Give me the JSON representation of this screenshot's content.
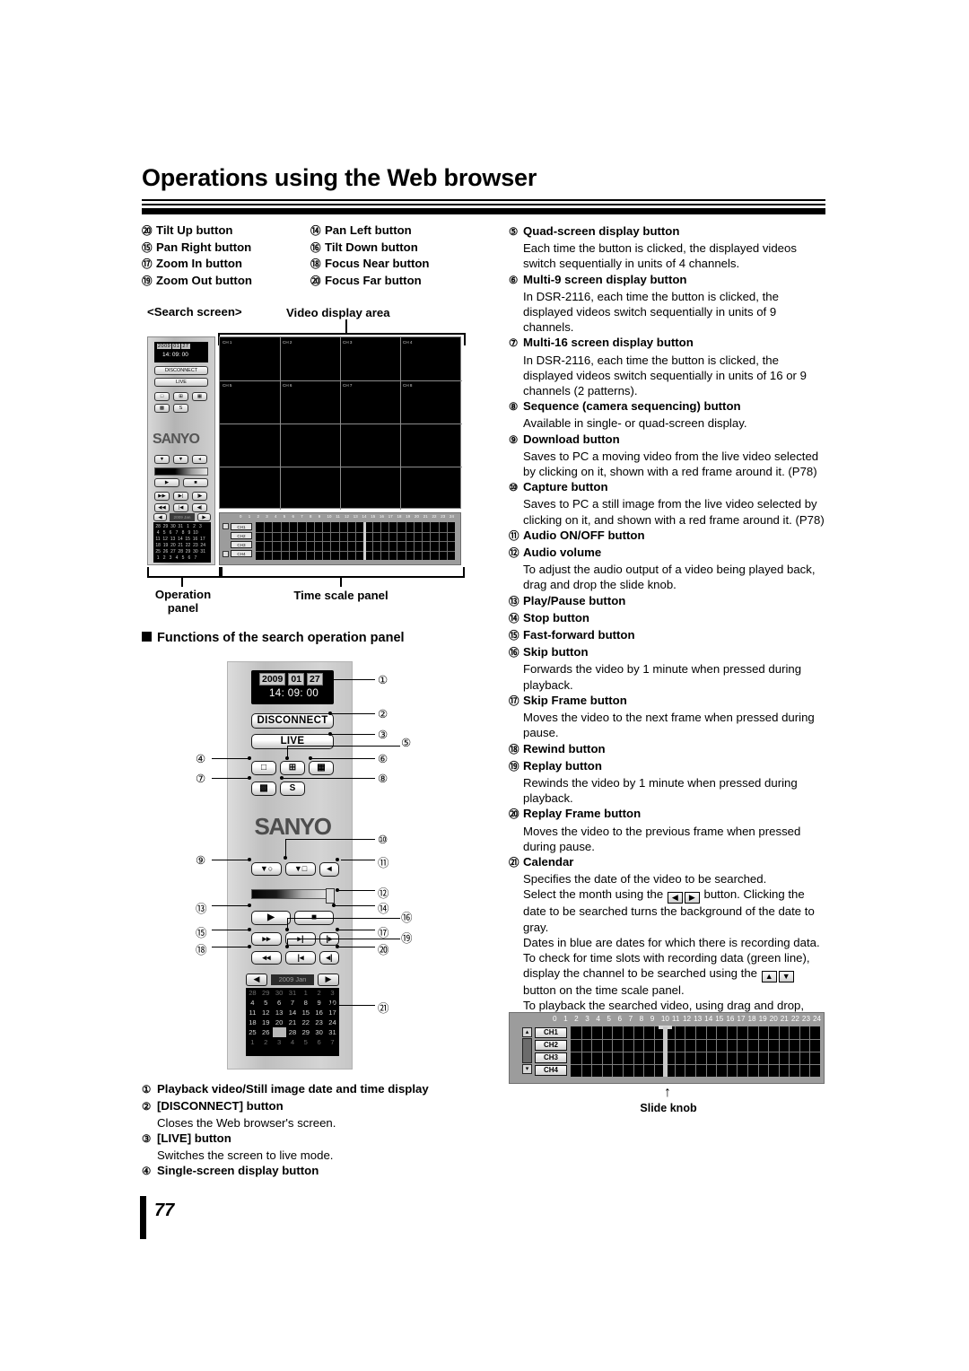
{
  "header": {
    "title": "Operations using the Web browser"
  },
  "ptz_list": {
    "column_a": [
      {
        "num": "⑳",
        "label": "Tilt Up button"
      },
      {
        "num": "⑮",
        "label": "Pan Right button"
      },
      {
        "num": "⑰",
        "label": "Zoom In button"
      },
      {
        "num": "⑲",
        "label": "Zoom Out button"
      }
    ],
    "column_b": [
      {
        "num": "⑭",
        "label": "Pan Left button"
      },
      {
        "num": "⑯",
        "label": "Tilt Down button"
      },
      {
        "num": "⑱",
        "label": "Focus Near button"
      },
      {
        "num": "⑳\u0000",
        "label": "Focus Far button"
      }
    ],
    "column_b_nums": [
      "⑭",
      "⑯",
      "⑱",
      "⑳"
    ],
    "column_b_num_20": "⑳"
  },
  "figure_search": {
    "caption": "<Search screen>",
    "video_area_label": "Video display area",
    "operation_panel_label_line1": "Operation",
    "operation_panel_label_line2": "panel",
    "time_scale_panel_label": "Time scale panel",
    "mini_panel": {
      "date_year": "2009",
      "date_month": "01",
      "date_day": "27",
      "time": "14: 09: 00",
      "disconnect": "DISCONNECT",
      "live": "LIVE",
      "brand": "SANYO",
      "s_button": "S",
      "calendar_month": "2009 Jan"
    },
    "video_channels": [
      "CH 1",
      "CH 2",
      "CH 3",
      "CH 4",
      "CH 5",
      "CH 6",
      "CH 7",
      "CH 8"
    ],
    "time_scale_channels": [
      "CH1",
      "CH2",
      "CH3",
      "CH4"
    ],
    "time_scale_hours": [
      "0",
      "1",
      "2",
      "3",
      "4",
      "5",
      "6",
      "7",
      "8",
      "9",
      "10",
      "11",
      "12",
      "13",
      "14",
      "15",
      "16",
      "17",
      "18",
      "19",
      "20",
      "21",
      "22",
      "23",
      "24"
    ]
  },
  "section_heading": "Functions of the search operation panel",
  "figure_panel": {
    "date_year": "2009",
    "date_month": "01",
    "date_day": "27",
    "time": "14: 09: 00",
    "disconnect_label": "DISCONNECT",
    "live_label": "LIVE",
    "brand": "SANYO",
    "single_icon": "□",
    "quad_icon": "⊞",
    "multi9_icon": "☷",
    "multi16_icon": "▒",
    "sequence_label": "S",
    "download_icon": "↓",
    "capture_icon": "↓",
    "audio_icon": "◂",
    "play_icon": "▶",
    "stop_icon": "■",
    "ff_icon": "▶▶",
    "skip_icon": "▶|",
    "skipframe_icon": "|▶",
    "rew_icon": "◀◀",
    "replay_icon": "|◀",
    "replayframe_icon": "◀|",
    "calendar_month": "2009 Jan",
    "calendar_prev": "◀",
    "calendar_next": "▶",
    "calendar_rows": [
      [
        "28",
        "29",
        "30",
        "31",
        "1",
        "2",
        "3"
      ],
      [
        "4",
        "5",
        "6",
        "7",
        "8",
        "9",
        "10"
      ],
      [
        "11",
        "12",
        "13",
        "14",
        "15",
        "16",
        "17"
      ],
      [
        "18",
        "19",
        "20",
        "21",
        "22",
        "23",
        "24"
      ],
      [
        "25",
        "26",
        "27",
        "28",
        "29",
        "30",
        "31"
      ],
      [
        "1",
        "2",
        "3",
        "4",
        "5",
        "6",
        "7"
      ]
    ],
    "calendar_selected": {
      "row": 4,
      "col": 2
    },
    "callouts": [
      "①",
      "②",
      "③",
      "④",
      "⑤",
      "⑥",
      "⑦",
      "⑧",
      "⑨",
      "⑩",
      "⑪",
      "⑫",
      "⑬",
      "⑭",
      "⑮",
      "⑯",
      "⑰",
      "⑱",
      "⑲",
      "⑳",
      "㉑"
    ]
  },
  "left_list": [
    {
      "num": "①",
      "title": "Playback video/Still image date and time display",
      "desc": ""
    },
    {
      "num": "②",
      "title": "[DISCONNECT] button",
      "desc": "Closes the Web browser's screen."
    },
    {
      "num": "③",
      "title": "[LIVE] button",
      "desc": "Switches the screen to live mode."
    },
    {
      "num": "④",
      "title": "Single-screen display button",
      "desc": ""
    }
  ],
  "right_list": [
    {
      "num": "⑤",
      "title": "Quad-screen display button",
      "desc": "Each time the button is clicked, the displayed videos switch sequentially in units of 4 channels."
    },
    {
      "num": "⑥",
      "title": "Multi-9 screen display button",
      "desc": "In DSR-2116, each time the button is clicked, the displayed videos switch sequentially in units of 9 channels."
    },
    {
      "num": "⑦",
      "title": "Multi-16 screen display button",
      "desc": "In DSR-2116, each time the button is clicked, the displayed videos switch sequentially in units of 16 or 9 channels (2 patterns)."
    },
    {
      "num": "⑧",
      "title": "Sequence (camera sequencing) button",
      "desc": "Available in single- or quad-screen display."
    },
    {
      "num": "⑨",
      "title": "Download button",
      "desc": "Saves to PC a moving video from the live video selected by clicking on it, shown with a red frame around it. (P78)"
    },
    {
      "num": "⑩",
      "title": "Capture button",
      "desc": "Saves to PC a still image from the live video selected by clicking on it, and shown with a red frame around it. (P78)"
    },
    {
      "num": "⑪",
      "title": "Audio ON/OFF button",
      "desc": ""
    },
    {
      "num": "⑫",
      "title": "Audio volume",
      "desc": "To adjust the audio output of a video being played back, drag and drop the slide knob."
    },
    {
      "num": "⑬",
      "title": "Play/Pause button",
      "desc": ""
    },
    {
      "num": "⑭",
      "title": "Stop button",
      "desc": ""
    },
    {
      "num": "⑮",
      "title": "Fast-forward button",
      "desc": ""
    },
    {
      "num": "⑯",
      "title": "Skip button",
      "desc": "Forwards the video by 1 minute when pressed during playback."
    },
    {
      "num": "⑰",
      "title": "Skip Frame button",
      "desc": "Moves the video to the next frame when pressed during pause."
    },
    {
      "num": "⑱",
      "title": "Rewind button",
      "desc": ""
    },
    {
      "num": "⑲",
      "title": "Replay button",
      "desc": "Rewinds the video by 1 minute when pressed during playback."
    },
    {
      "num": "⑳",
      "title": "Replay Frame button",
      "desc": "Moves the video to the previous frame when pressed during pause."
    }
  ],
  "calendar_entry": {
    "num": "㉑",
    "title": "Calendar",
    "p1": "Specifies the date of the video to be searched.",
    "p2a": "Select the month using the",
    "p2_key_left": "◀",
    "p2_key_right": "▶",
    "p2b": "button. Clicking the date to be searched turns the background of the date to gray.",
    "p3": "Dates in blue are dates for which there is recording data.",
    "p4a": "To check for time slots with recording data (green line), display the channel to be searched using the",
    "p4_key_up": "▲",
    "p4_key_down": "▼",
    "p4b": "button on the time scale panel.",
    "p5": "To playback the searched video, using drag and drop, move the slide knob of the time scale to the time to be played back and click the Play button."
  },
  "figure_timescale": {
    "hours": [
      "0",
      "1",
      "2",
      "3",
      "4",
      "5",
      "6",
      "7",
      "8",
      "9",
      "10",
      "11",
      "12",
      "13",
      "14",
      "15",
      "16",
      "17",
      "18",
      "19",
      "20",
      "21",
      "22",
      "23",
      "24"
    ],
    "channels": [
      "CH1",
      "CH2",
      "CH3",
      "CH4"
    ],
    "nav_up": "▴",
    "nav_down": "▾",
    "slide_knob_label": "Slide knob",
    "arrow": "↑"
  },
  "footer": {
    "page_number": "77"
  }
}
